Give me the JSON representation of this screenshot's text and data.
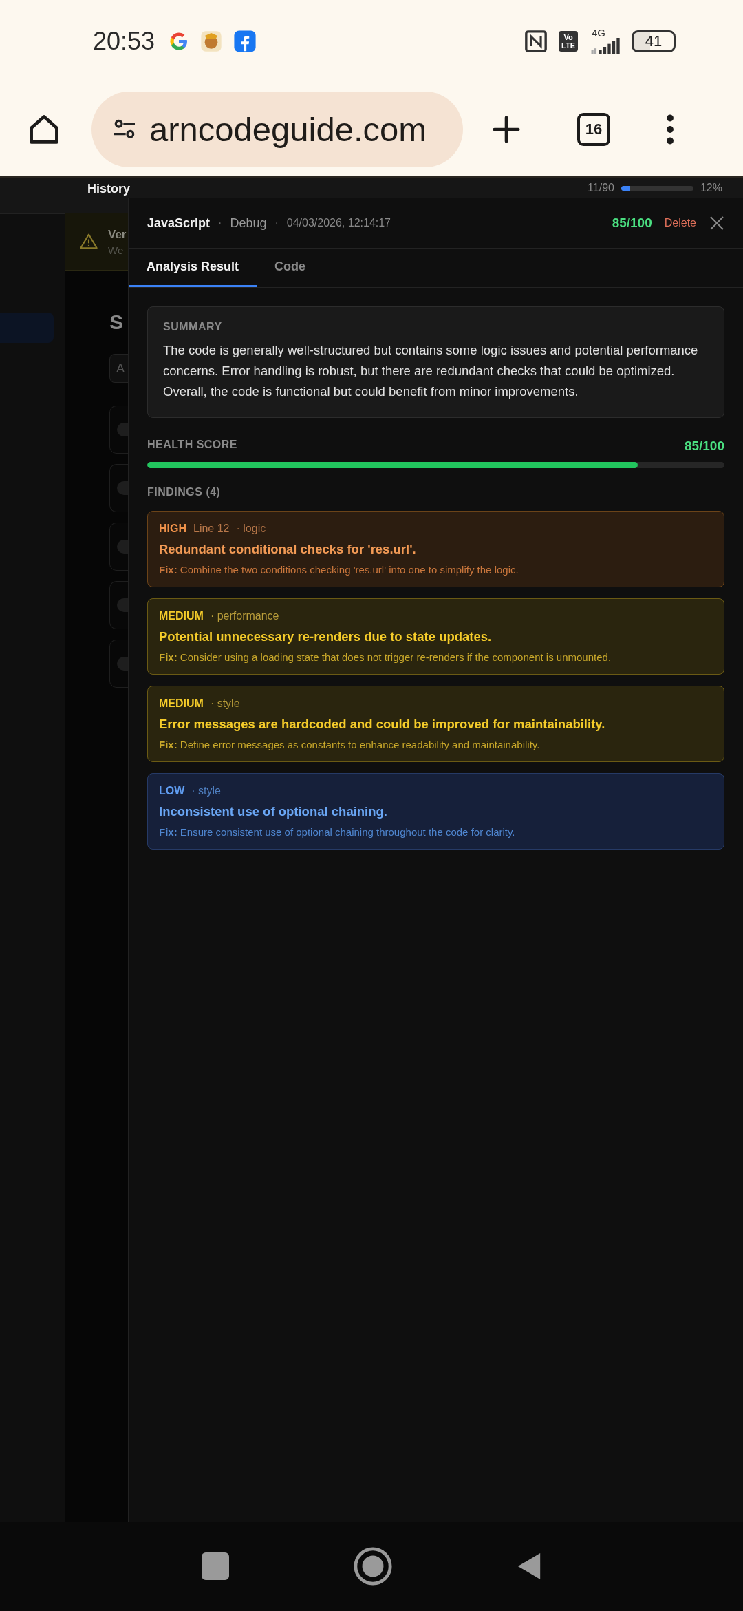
{
  "status_bar": {
    "time": "20:53",
    "volte": {
      "top": "Vo",
      "bottom": "LTE"
    },
    "network": "4G",
    "battery": "41"
  },
  "browser": {
    "url": "arncodeguide.com",
    "tab_count": "16"
  },
  "background_page": {
    "header_title": "History",
    "usage": "11/90",
    "usage_bar": {
      "level": 0.12
    },
    "usage_percent": "12%",
    "banner": {
      "title": "Ver",
      "text": "We"
    },
    "heading": "S",
    "field_placeholder": "A"
  },
  "modal": {
    "language": "JavaScript",
    "mode": "Debug",
    "separators": [
      "·",
      "·"
    ],
    "date": "04/03/2026, 12:14:17",
    "score": "85/100",
    "delete": "Delete",
    "tabs": [
      {
        "label": "Analysis Result",
        "selected": true
      },
      {
        "label": "Code",
        "selected": false
      }
    ],
    "summary": {
      "label": "SUMMARY",
      "text": "The code is generally well-structured but contains some logic issues and potential performance concerns. Error handling is robust, but there are redundant checks that could be optimized. Overall, the code is functional but could benefit from minor improvements."
    },
    "health": {
      "label": "HEALTH SCORE",
      "score": "85/100",
      "level": 0.85
    },
    "findings_label": "FINDINGS (4)",
    "findings": [
      {
        "kind": "high",
        "severity": "HIGH",
        "line": "Line 12",
        "category": "· logic",
        "title": "Redundant conditional checks for 'res.url'.",
        "fix": "**Fix:** Combine the two conditions checking 'res.url' into one to simplify the logic."
      },
      {
        "kind": "medium",
        "severity": "MEDIUM",
        "category": "· performance",
        "title": "Potential unnecessary re-renders due to state updates.",
        "fix": "**Fix:** Consider using a loading state that does not trigger re-renders if the component is unmounted."
      },
      {
        "kind": "medium",
        "severity": "MEDIUM",
        "category": "· style",
        "title": "Error messages are hardcoded and could be improved for maintainability.",
        "fix": "**Fix:** Define error messages as constants to enhance readability and maintainability."
      },
      {
        "kind": "low",
        "severity": "LOW",
        "category": "· style",
        "title": "Inconsistent use of optional chaining.",
        "fix": "**Fix:** Ensure consistent use of optional chaining throughout the code for clarity."
      }
    ]
  }
}
